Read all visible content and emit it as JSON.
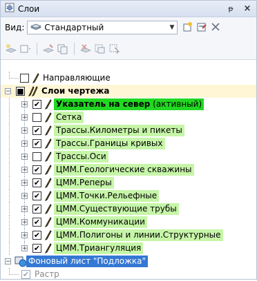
{
  "window": {
    "title": "Слои",
    "pin": "ᵽ",
    "close": "×"
  },
  "view": {
    "label": "Вид:",
    "selected": "Стандартный"
  },
  "tree": {
    "guides": "Направляющие",
    "group": "Слои чертежа",
    "layers": [
      {
        "name": "Указатель на север",
        "suffix": " (активный)",
        "checked": true,
        "bright": true
      },
      {
        "name": "Сетка",
        "checked": false
      },
      {
        "name": "Трассы.Километры и пикеты",
        "checked": true
      },
      {
        "name": "Трассы.Границы кривых",
        "checked": true
      },
      {
        "name": "Трассы.Оси",
        "checked": false
      },
      {
        "name": "ЦММ.Геологические скважины",
        "checked": true
      },
      {
        "name": "ЦММ.Реперы",
        "checked": true
      },
      {
        "name": "ЦММ.Точки.Рельефные",
        "checked": true
      },
      {
        "name": "ЦММ.Существующие трубы",
        "checked": true
      },
      {
        "name": "ЦММ.Коммуникации",
        "checked": true
      },
      {
        "name": "ЦММ.Полигоны и линии.Структурные",
        "checked": true
      },
      {
        "name": "ЦММ.Триангуляция",
        "checked": true
      }
    ],
    "background": "Фоновый лист \"Подложка\"",
    "raster": "Растр"
  },
  "colors": {
    "layer_bg": "#c6f5a8",
    "active_bg": "#22d822",
    "selected_bg": "#3478d4",
    "group_bg": "#fff6d6"
  }
}
